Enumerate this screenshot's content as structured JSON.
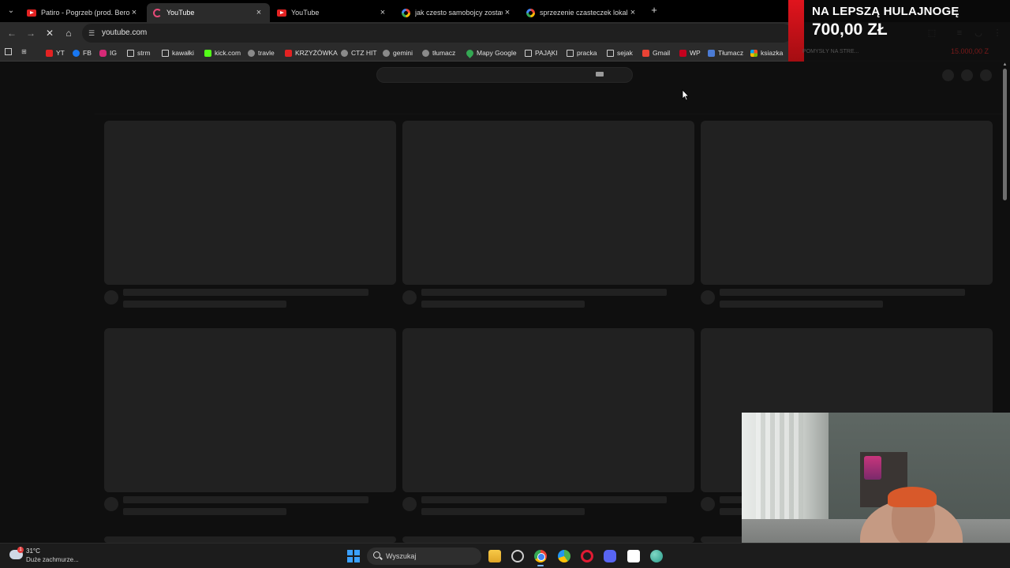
{
  "browser": {
    "tabs": [
      {
        "title": "Patiro - Pogrzeb (prod. Bero) - Y",
        "icon": "youtube-icon",
        "active": false
      },
      {
        "title": "YouTube",
        "icon": "loading-icon",
        "active": true
      },
      {
        "title": "YouTube",
        "icon": "youtube-icon",
        "active": false
      },
      {
        "title": "jak czesto samobojcy zostawiaja",
        "icon": "google-icon",
        "active": false
      },
      {
        "title": "sprzezenie czasteczek lokalnych",
        "icon": "google-icon",
        "active": false
      }
    ],
    "close_glyph": "×",
    "new_tab_glyph": "+",
    "address": "youtube.com",
    "bookmarks": [
      {
        "label": "YT",
        "icon": "youtube-icon"
      },
      {
        "label": "FB",
        "icon": "facebook-icon"
      },
      {
        "label": "IG",
        "icon": "instagram-icon"
      },
      {
        "label": "strm",
        "icon": "folder-icon"
      },
      {
        "label": "kawałki",
        "icon": "folder-icon"
      },
      {
        "label": "kick.com",
        "icon": "kick-icon"
      },
      {
        "label": "travle",
        "icon": "compass-icon"
      },
      {
        "label": "KRZYŻÓWKA",
        "icon": "crossword-icon"
      },
      {
        "label": "CTZ HIT",
        "icon": "link-icon"
      },
      {
        "label": "gemini",
        "icon": "gemini-icon"
      },
      {
        "label": "tłumacz",
        "icon": "translate-icon"
      },
      {
        "label": "Mapy Google",
        "icon": "maps-icon"
      },
      {
        "label": "PAJĄKI",
        "icon": "folder-icon"
      },
      {
        "label": "pracka",
        "icon": "folder-icon"
      },
      {
        "label": "sejak",
        "icon": "folder-icon"
      },
      {
        "label": "Gmail",
        "icon": "gmail-icon"
      },
      {
        "label": "WP",
        "icon": "wp-icon"
      },
      {
        "label": "Tłumacz",
        "icon": "translate-icon"
      },
      {
        "label": "ksiazka",
        "icon": "microsoft-icon"
      }
    ]
  },
  "overlay": {
    "promo_title": "NA LEPSZĄ HULAJNOGĘ",
    "promo_amount": "700,00 ZŁ",
    "promo_caption": "POMYSŁY NA STRE...",
    "promo_caption_right": "15.000,00 Z",
    "accent_color": "#e0141d"
  },
  "taskbar": {
    "temperature": "31°C",
    "weather": "Duże zachmurze...",
    "weather_badge": "1",
    "search_placeholder": "Wyszukaj",
    "apps": [
      "windows-start-icon",
      "file-explorer-icon",
      "steam-icon",
      "chrome-icon",
      "browser-icon",
      "opera-icon",
      "discord-icon",
      "notion-icon",
      "globe-icon"
    ]
  },
  "colors": {
    "page_bg": "#0f0f0f",
    "skeleton": "#212121",
    "toolbar": "#2b2b2b"
  }
}
